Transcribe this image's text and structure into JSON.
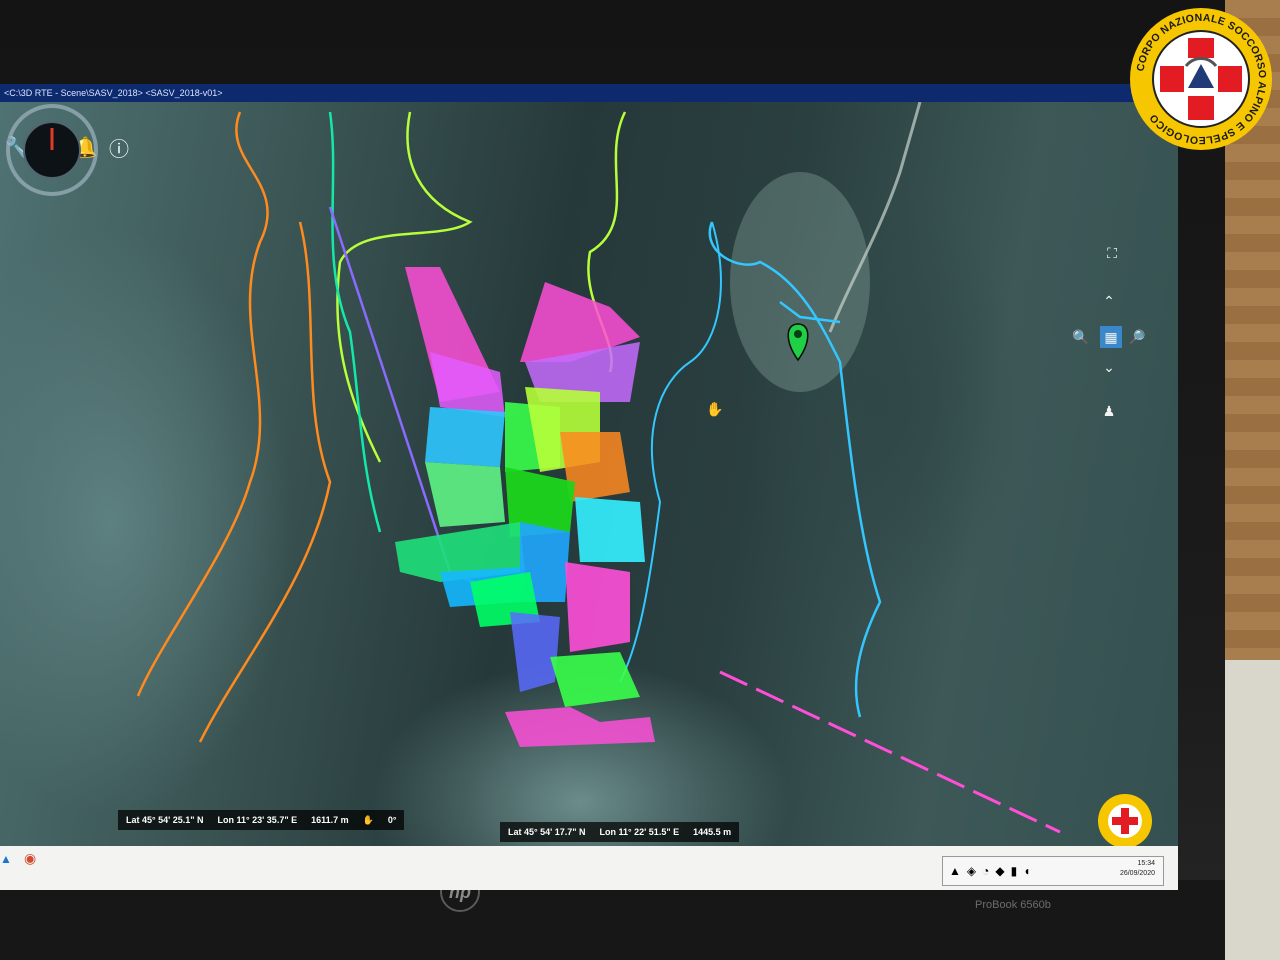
{
  "window": {
    "title": "<C:\\3D RTE - Scene\\SASV_2018>   <SASV_2018-v01>"
  },
  "toolbar": {
    "items": [
      {
        "icon": "wrench-icon"
      },
      {
        "icon": "search-icon"
      },
      {
        "icon": "bell-icon"
      },
      {
        "icon": "info-icon"
      }
    ]
  },
  "map": {
    "marker_color": "#1fcf45",
    "cursor": "hand-icon"
  },
  "status": {
    "left": {
      "lat": "Lat 45° 54' 25.1\" N",
      "lon": "Lon 11° 23' 35.7\" E",
      "alt": "1611.7 m"
    },
    "heading": "0°",
    "right": {
      "lat": "Lat 45° 54' 17.7\" N",
      "lon": "Lon 11° 22' 51.5\" E",
      "alt": "1445.5 m"
    }
  },
  "taskbar": {
    "time": "15:34",
    "date": "26/09/2020"
  },
  "laptop": {
    "brand": "hp",
    "model": "ProBook 6560b"
  },
  "badge": {
    "text": "CORPO NAZIONALE SOCCORSO ALPINO E SPELEOLOGICO",
    "color": "#e31b23",
    "ring_color": "#f6c700"
  },
  "colors": {
    "tracks": [
      "#ff8a1e",
      "#b6ff3a",
      "#34c6ff",
      "#ff4fd8",
      "#8a6bff",
      "#14e8a8"
    ]
  }
}
